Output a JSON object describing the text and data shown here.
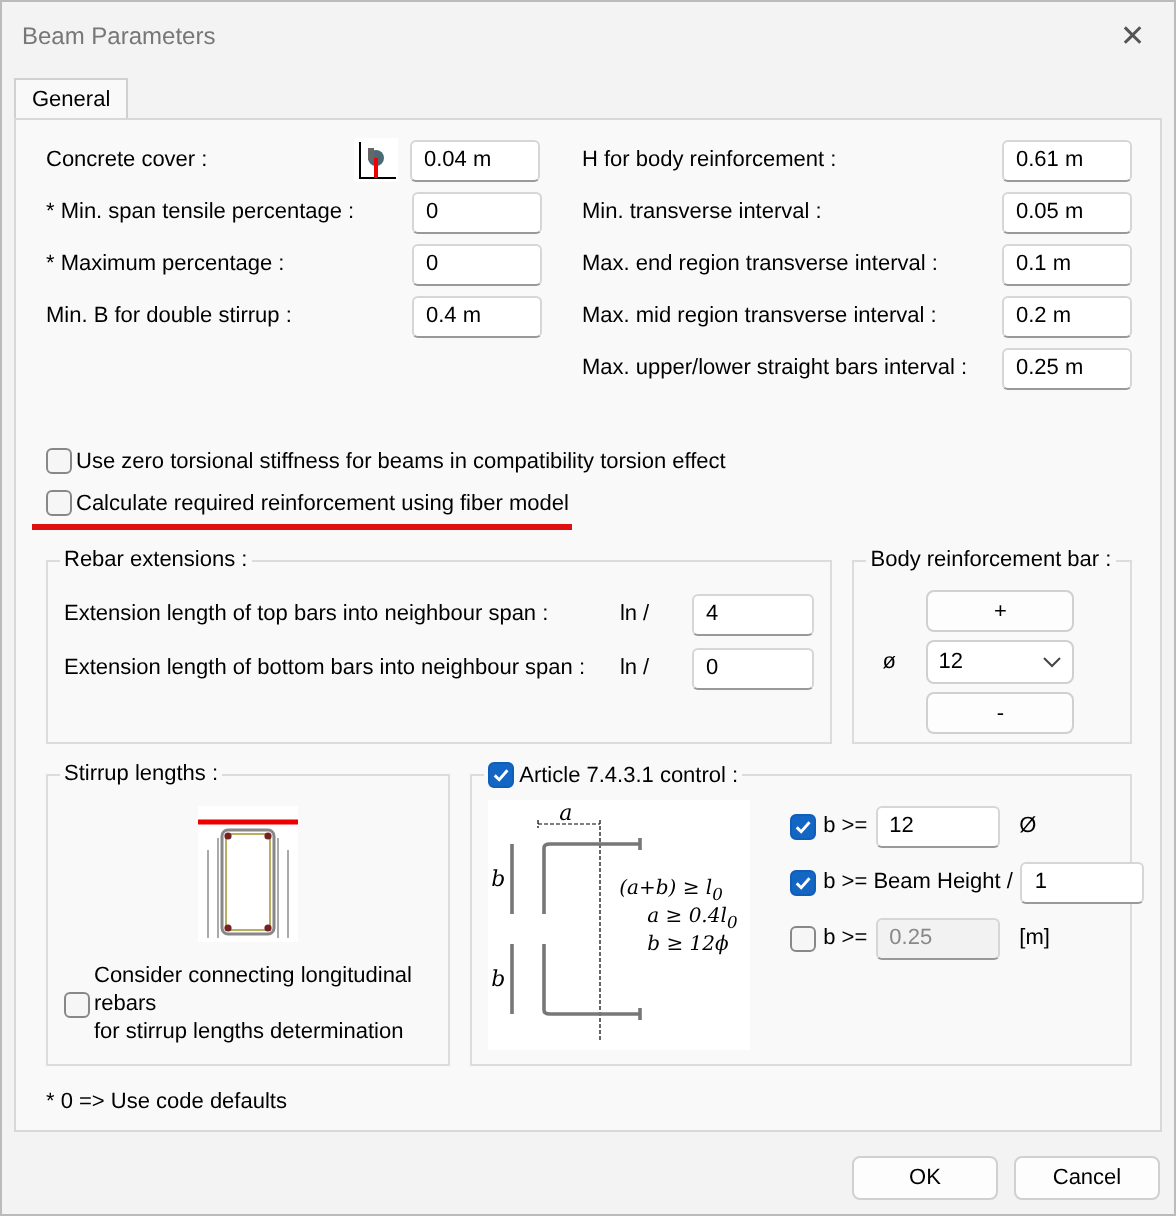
{
  "window": {
    "title": "Beam Parameters",
    "close": "✕"
  },
  "tabs": [
    {
      "label": "General",
      "selected": true
    }
  ],
  "left_fields": [
    {
      "label": "Concrete cover :",
      "value": "0.04 m",
      "kind": "with_icon"
    },
    {
      "label": "* Min. span tensile percentage :",
      "value": "0",
      "kind": "plain"
    },
    {
      "label": "* Maximum percentage :",
      "value": "0",
      "kind": "plain"
    },
    {
      "label": "Min. B for double stirrup :",
      "value": "0.4 m",
      "kind": "plain"
    }
  ],
  "right_fields": [
    {
      "label": "H for body reinforcement :",
      "value": "0.61 m"
    },
    {
      "label": "Min. transverse interval :",
      "value": "0.05 m"
    },
    {
      "label": "Max. end region transverse interval :",
      "value": "0.1 m"
    },
    {
      "label": "Max. mid region transverse interval :",
      "value": "0.2 m"
    },
    {
      "label": "Max. upper/lower straight bars interval :",
      "value": "0.25 m"
    }
  ],
  "options": [
    {
      "label": "Use zero torsional stiffness for beams in compatibility torsion effect",
      "checked": false,
      "underlined": false
    },
    {
      "label": "Calculate required reinforcement using fiber model",
      "checked": false,
      "underlined": true
    }
  ],
  "rebar_extensions": {
    "title": "Rebar extensions :",
    "rows": [
      {
        "label": "Extension length of top bars into neighbour span :",
        "unit": "ln /",
        "value": "4"
      },
      {
        "label": "Extension length of bottom bars into neighbour span :",
        "unit": "ln /",
        "value": "0"
      }
    ]
  },
  "body_bar": {
    "title": "Body reinforcement bar :",
    "plus": "+",
    "symbol": "ø",
    "diameter": "12",
    "minus": "-"
  },
  "stirrup_lengths": {
    "title": "Stirrup lengths :",
    "checkbox": {
      "label": "Consider connecting longitudinal rebars\nfor stirrup lengths determination",
      "checked": false
    }
  },
  "article": {
    "title": "Article 7.4.3.1 control :",
    "checked": true,
    "diagram": {
      "a": "a",
      "b_labels": [
        "b",
        "b"
      ],
      "formulas": [
        "(a+b) ≥ l$_{0}$",
        "a ≥ 0.4l$_{0}$",
        "b ≥ 12ϕ"
      ]
    },
    "conditions": [
      {
        "label": "b >=",
        "checked": true,
        "value": "12",
        "suffix": "Ø",
        "disabled": false
      },
      {
        "label": "b >= Beam Height /",
        "checked": true,
        "value": "1",
        "disabled": false
      },
      {
        "label": "b >=",
        "checked": false,
        "value": "0.25",
        "suffix": "[m]",
        "disabled": true
      }
    ]
  },
  "footnote": "* 0 => Use code defaults",
  "buttons": [
    "OK",
    "Cancel"
  ]
}
